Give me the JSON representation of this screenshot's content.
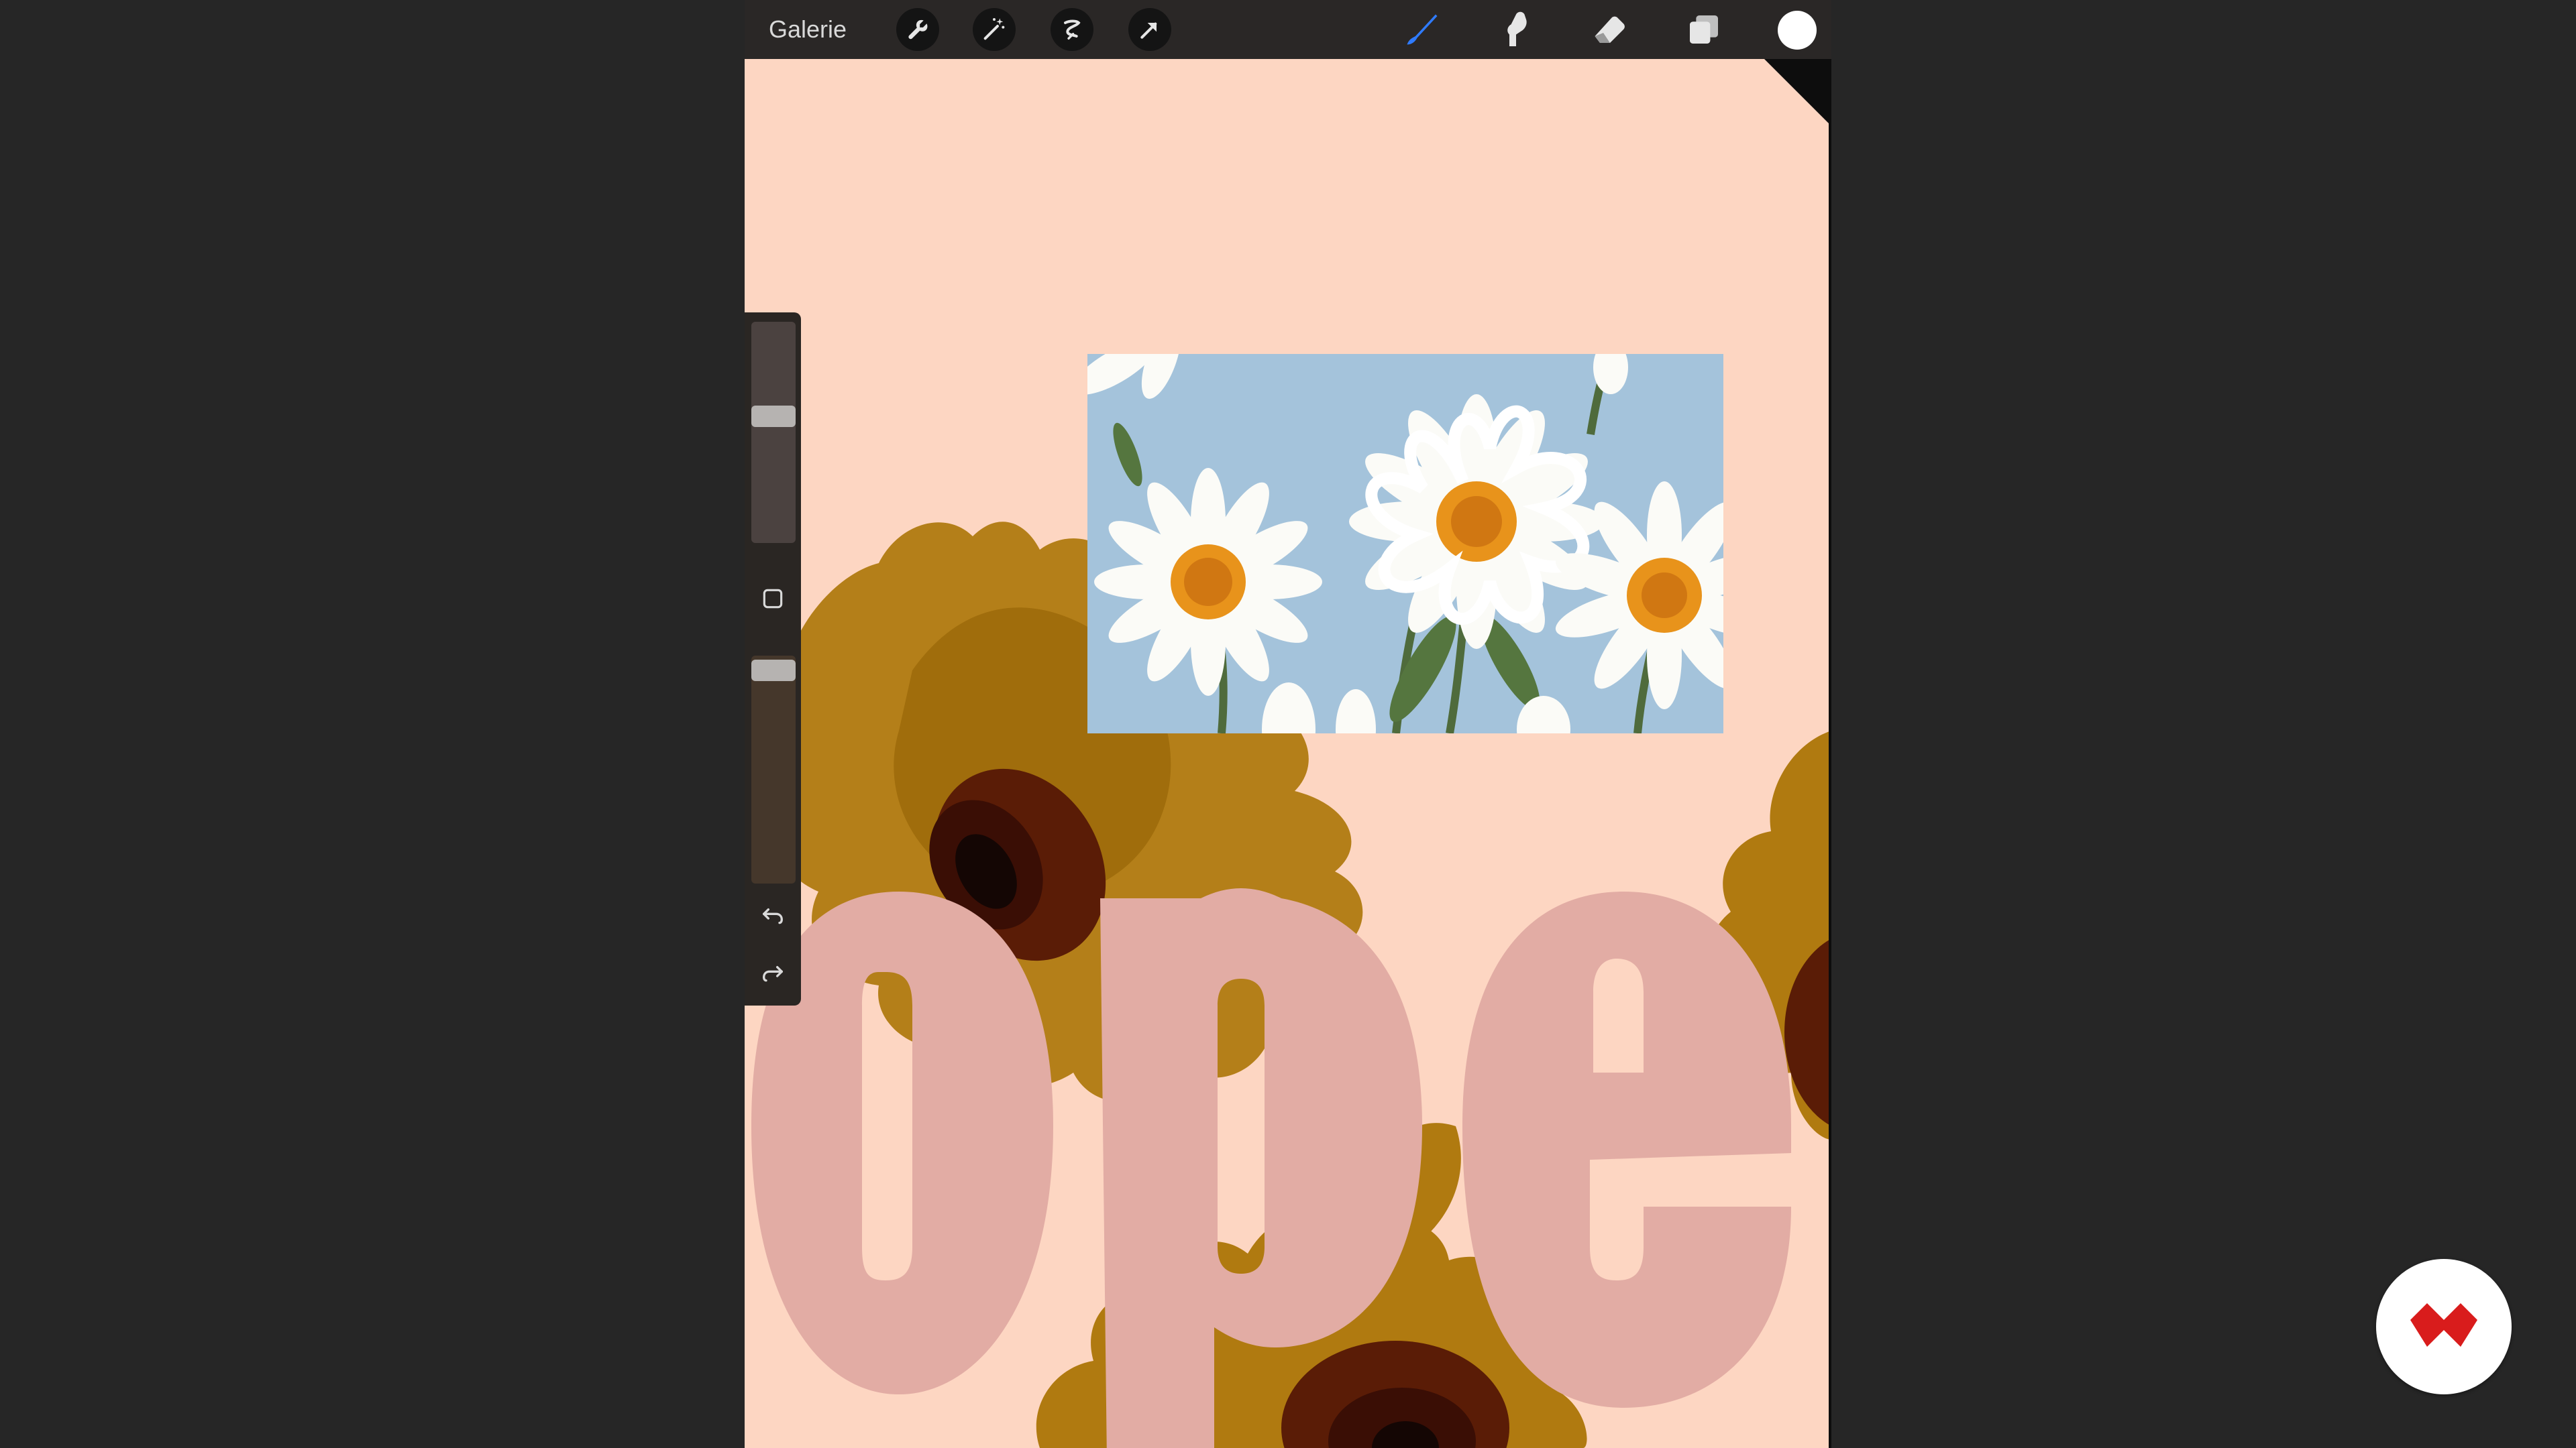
{
  "toolbar": {
    "gallery_label": "Galerie",
    "left_tools": [
      "wrench-icon",
      "magic-wand-icon",
      "selection-icon",
      "transform-arrow-icon"
    ],
    "right_tools": [
      "brush-icon",
      "smudge-icon",
      "eraser-icon",
      "layers-icon"
    ],
    "active_tool": "brush-icon",
    "current_color": "#ffffff"
  },
  "sidebar": {
    "brush_size_level": 0.58,
    "opacity_level": 0.98,
    "icons": [
      "modify-square-icon",
      "undo-icon",
      "redo-icon"
    ]
  },
  "canvas": {
    "background_color": "#fdd6c2",
    "lettering": "ope",
    "lettering_color": "#e2aca4"
  },
  "logo": {
    "name": "red-chevron-logo-icon",
    "color": "#d91c1c"
  }
}
